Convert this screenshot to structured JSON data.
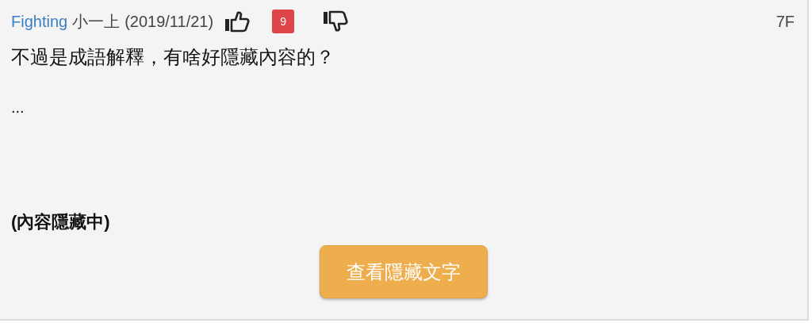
{
  "post": {
    "author": "Fighting",
    "grade": "小一上",
    "date": "(2019/11/21)",
    "likes": "9",
    "floor": "7F",
    "body": "不過是成語解釋，有啥好隱藏內容的？",
    "ellipsis": "...",
    "hidden_note": "(內容隱藏中)",
    "reveal_button": "查看隱藏文字"
  }
}
